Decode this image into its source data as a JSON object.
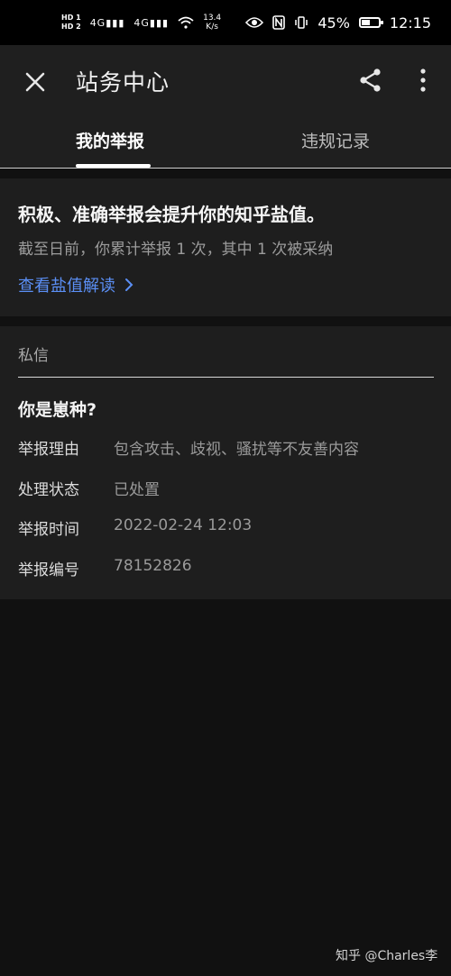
{
  "status_bar": {
    "hd1": "HD 1",
    "hd2": "HD 2",
    "signal1": "4G",
    "signal2": "4G",
    "speed_value": "13.4",
    "speed_unit": "K/s",
    "battery_percent": "45%",
    "time": "12:15"
  },
  "app_bar": {
    "title": "站务中心"
  },
  "tabs": [
    {
      "label": "我的举报"
    },
    {
      "label": "违规记录"
    }
  ],
  "summary": {
    "headline": "积极、准确举报会提升你的知乎盐值。",
    "stats": "截至日前，你累计举报 1 次，其中 1 次被采纳",
    "link_label": "查看盐值解读"
  },
  "report": {
    "category": "私信",
    "title": "你是崽种?",
    "rows": [
      {
        "label": "举报理由",
        "value": "包含攻击、歧视、骚扰等不友善内容"
      },
      {
        "label": "处理状态",
        "value": "已处置"
      },
      {
        "label": "举报时间",
        "value": "2022-02-24 12:03"
      },
      {
        "label": "举报编号",
        "value": "78152826"
      }
    ]
  },
  "watermark": "知乎 @Charles李",
  "colors": {
    "background": "#1f1f1f",
    "link": "#5b8ff5",
    "status_bar": "#000000"
  },
  "icons": [
    "close-icon",
    "share-icon",
    "more-vert-icon",
    "chevron-right-icon",
    "wifi-icon",
    "eye-icon",
    "nfc-icon",
    "vibrate-icon",
    "battery-icon"
  ]
}
